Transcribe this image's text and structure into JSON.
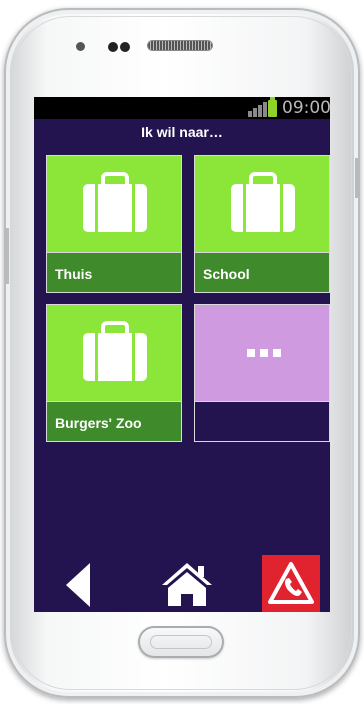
{
  "status_bar": {
    "time": "09:00"
  },
  "screen": {
    "title": "Ik wil naar…"
  },
  "destinations": [
    {
      "label": "Thuis",
      "icon": "suitcase-icon"
    },
    {
      "label": "School",
      "icon": "suitcase-icon"
    },
    {
      "label": "Burgers' Zoo",
      "icon": "suitcase-icon"
    }
  ],
  "more_tile": {
    "icon": "more-dots-icon"
  },
  "navigation": {
    "back_icon": "back-arrow-icon",
    "home_icon": "home-icon",
    "emergency_icon": "emergency-call-icon"
  },
  "colors": {
    "background": "#231450",
    "tile_top": "#8ce63a",
    "tile_bottom": "#3f8a2a",
    "more_tile": "#cf9adf",
    "emergency": "#e1222f"
  }
}
